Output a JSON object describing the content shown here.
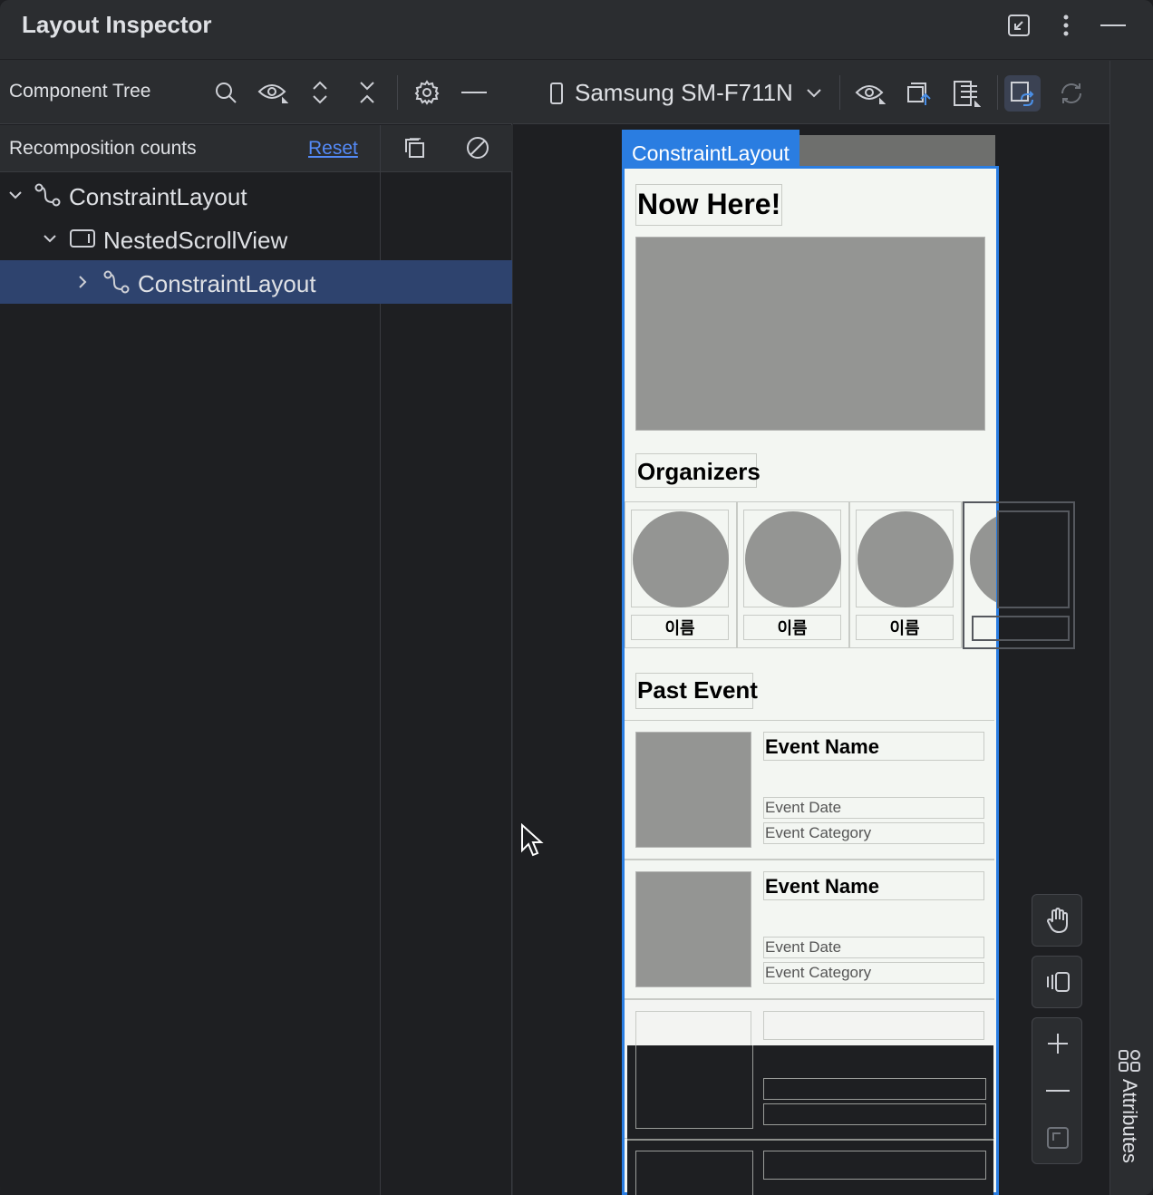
{
  "window": {
    "title": "Layout Inspector"
  },
  "component_tree": {
    "title": "Component Tree",
    "recomposition_label": "Recomposition counts",
    "reset_label": "Reset",
    "nodes": [
      {
        "label": "ConstraintLayout",
        "expanded": true,
        "depth": 0
      },
      {
        "label": "NestedScrollView",
        "expanded": true,
        "depth": 1
      },
      {
        "label": "ConstraintLayout",
        "expanded": false,
        "depth": 2,
        "selected": true
      }
    ]
  },
  "device_panel": {
    "device_name": "Samsung SM-F711N",
    "selected_tag": "ConstraintLayout"
  },
  "app_screen": {
    "now_here": "Now Here!",
    "organizers": "Organizers",
    "organizer_names": [
      "이름",
      "이름",
      "이름"
    ],
    "past_event": "Past Event",
    "events": [
      {
        "name": "Event Name",
        "date": "Event Date",
        "category": "Event Category"
      },
      {
        "name": "Event Name",
        "date": "Event Date",
        "category": "Event Category"
      }
    ]
  },
  "sidebar": {
    "attributes_label": "Attributes"
  },
  "colors": {
    "accent": "#2a7de1",
    "selection": "#2e436e",
    "link": "#548af7"
  }
}
